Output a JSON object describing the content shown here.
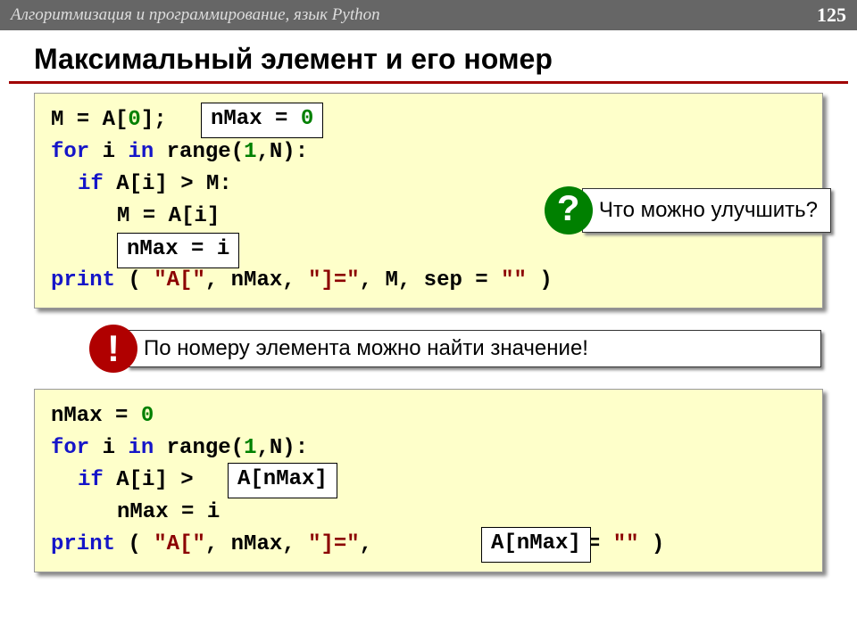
{
  "header": {
    "subject": "Алгоритмизация и программирование, язык Python",
    "page": "125"
  },
  "title": "Максимальный элемент и его номер",
  "block1": {
    "l1a": "M = A[",
    "l1b": "0",
    "l1c": "];",
    "box1": "nMax = 0",
    "l2a": "for",
    "l2b": " i ",
    "l2c": "in",
    "l2d": " range(",
    "l2e": "1",
    "l2f": ",N):",
    "l3a": "if",
    "l3b": " A[i] > M:",
    "l4": "M = A[i]",
    "box2": "nMax = i",
    "l5a": "print",
    "l5b": " ( ",
    "l5c": "\"A[\"",
    "l5d": ", nMax, ",
    "l5e": "\"]=\"",
    "l5f": ", M, sep = ",
    "l5g": "\"\"",
    "l5h": " )"
  },
  "question": {
    "mark": "?",
    "text": "Что можно улучшить?"
  },
  "exclaim": {
    "mark": "!",
    "text": "По номеру элемента можно найти значение!"
  },
  "block2": {
    "l1a": "nMax = ",
    "l1b": "0",
    "l2a": "for",
    "l2b": " i ",
    "l2c": "in",
    "l2d": " range(",
    "l2e": "1",
    "l2f": ",N):",
    "l3a": "if",
    "l3b": " A[i] > ",
    "box1": "A[nMax]",
    "l4": "nMax = i",
    "l5a": "print",
    "l5b": " ( ",
    "l5c": "\"A[\"",
    "l5d": ", nMax, ",
    "l5e": "\"]=\"",
    "l5f": ",",
    "box2": "A[nMax]",
    "l5g": ", sep = ",
    "l5h": "\"\"",
    "l5i": " )"
  }
}
